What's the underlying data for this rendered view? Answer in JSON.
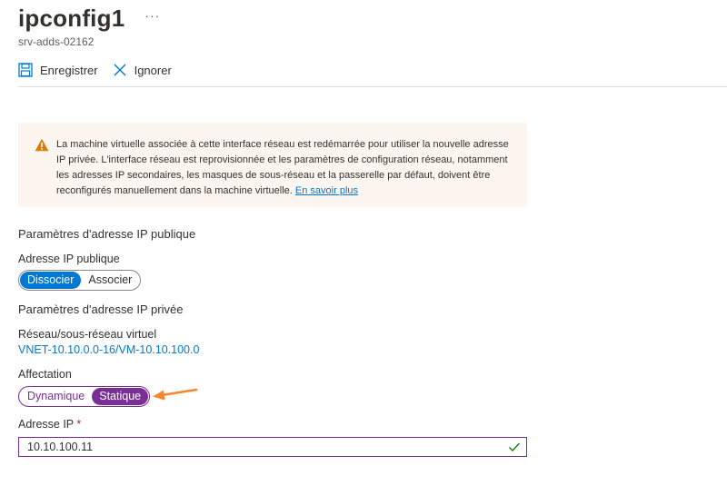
{
  "header": {
    "title": "ipconfig1",
    "more": "···",
    "subtitle": "srv-adds-02162"
  },
  "toolbar": {
    "save_label": "Enregistrer",
    "discard_label": "Ignorer"
  },
  "warning": {
    "text": "La machine virtuelle associée à cette interface réseau est redémarrée pour utiliser la nouvelle adresse IP privée. L'interface réseau est reprovisionnée et les paramètres de configuration réseau, notamment les adresses IP secondaires, les masques de sous-réseau et la passerelle par défaut, doivent être reconfigurés manuellement dans la machine virtuelle.",
    "link": "En savoir plus"
  },
  "public_ip": {
    "section_title": "Paramètres d'adresse IP publique",
    "label": "Adresse IP publique",
    "options": [
      "Dissocier",
      "Associer"
    ],
    "selected": "Dissocier"
  },
  "private_ip": {
    "section_title": "Paramètres d'adresse IP privée",
    "vnet_label": "Réseau/sous-réseau virtuel",
    "vnet_value": "VNET-10.10.0.0-16/VM-10.10.100.0",
    "assignment_label": "Affectation",
    "assignment_options": [
      "Dynamique",
      "Statique"
    ],
    "assignment_selected": "Statique",
    "ip_label": "Adresse IP",
    "ip_required": "*",
    "ip_value": "10.10.100.11"
  },
  "colors": {
    "accent_blue": "#0078d4",
    "accent_purple": "#7a2f96",
    "warning_bg": "#fdf6f0",
    "warning_icon": "#d67f0a",
    "annotation_arrow": "#f7862a",
    "valid_check": "#107c10"
  },
  "icons": [
    "save-icon",
    "close-icon",
    "warning-icon",
    "check-icon",
    "annotation-arrow"
  ]
}
